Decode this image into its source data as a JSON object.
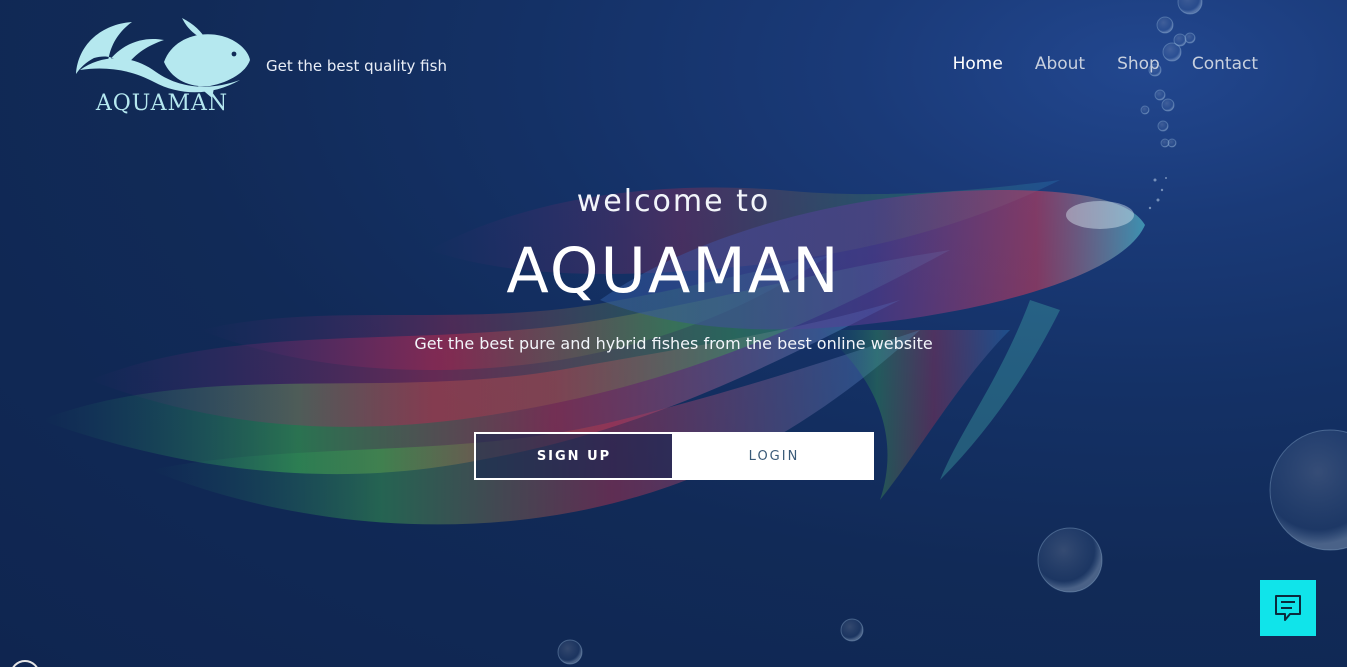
{
  "brand": {
    "logo_text": "AQUAMAN",
    "logo_icon": "fish-icon",
    "tagline": "Get the best quality fish"
  },
  "nav": {
    "items": [
      {
        "label": "Home",
        "active": true
      },
      {
        "label": "About",
        "active": false
      },
      {
        "label": "Shop",
        "active": false
      },
      {
        "label": "Contact",
        "active": false
      }
    ]
  },
  "hero": {
    "pre_title": "welcome to",
    "title": "AQUAMAN",
    "subtitle": "Get the best pure and hybrid fishes from the best online website",
    "signup_label": "SIGN UP",
    "login_label": "LOGIN"
  },
  "chat": {
    "icon": "chat-icon"
  },
  "colors": {
    "background": "#112a57",
    "logo": "#b5e8ef",
    "chat_button": "#10e4ea",
    "login_text": "#3a5a78"
  }
}
